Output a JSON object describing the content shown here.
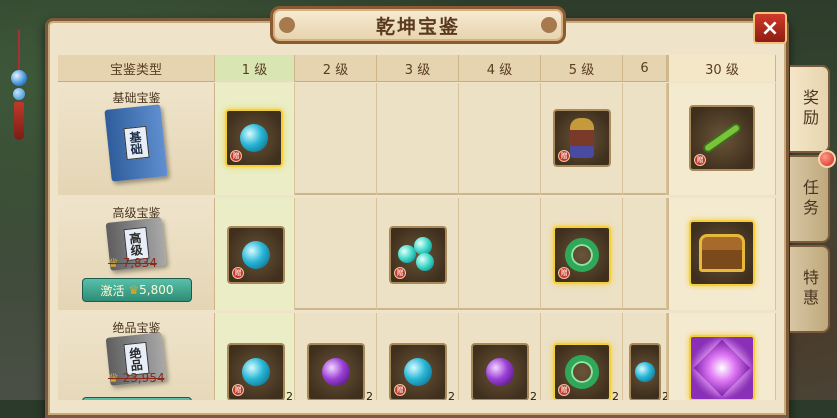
{
  "title": "乾坤宝鉴",
  "close_icon": "×",
  "header": {
    "type_col": "宝鉴类型",
    "levels": [
      "1 级",
      "2 级",
      "3 级",
      "4 级",
      "5 级",
      "6",
      "30 级"
    ]
  },
  "rows": [
    {
      "name": "基础宝鉴",
      "book_label": "基础",
      "items": [
        {
          "icon": "blue-orb-icon",
          "qty": ""
        },
        null,
        null,
        null,
        {
          "icon": "warrior-figure-icon",
          "qty": ""
        },
        null,
        {
          "icon": "green-bow-icon",
          "qty": ""
        }
      ]
    },
    {
      "name": "高级宝鉴",
      "book_label": "高级",
      "old_price": "7,834",
      "activate_label": "激活",
      "activate_price": "5,800",
      "items": [
        {
          "icon": "blue-orb-icon",
          "qty": ""
        },
        null,
        {
          "icon": "cyan-orbs-icon",
          "qty": ""
        },
        null,
        {
          "icon": "jade-pendant-icon",
          "qty": ""
        },
        null,
        {
          "icon": "treasure-chest-icon",
          "qty": ""
        }
      ]
    },
    {
      "name": "绝品宝鉴",
      "book_label": "绝品",
      "old_price": "23,954",
      "items": [
        {
          "icon": "blue-orb-icon",
          "qty": "2"
        },
        {
          "icon": "purple-orb-icon",
          "qty": "2"
        },
        {
          "icon": "blue-orb-icon",
          "qty": "2"
        },
        {
          "icon": "purple-orb-icon",
          "qty": "2"
        },
        {
          "icon": "jade-pendant-icon",
          "qty": "2"
        },
        {
          "icon": "blue-orb-icon",
          "qty": "2"
        },
        {
          "icon": "purple-crystal-icon",
          "qty": ""
        }
      ]
    }
  ],
  "tabs": [
    "奖励",
    "任务",
    "特惠"
  ],
  "colors": {
    "accent": "#f3d03a",
    "activate": "#2f8c76",
    "close": "#d03a2a"
  }
}
